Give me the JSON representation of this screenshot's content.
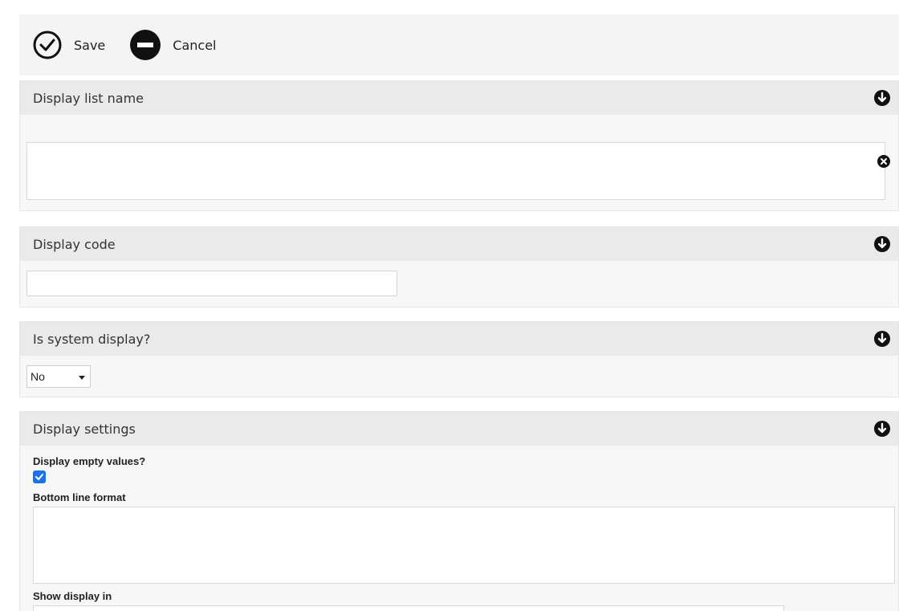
{
  "toolbar": {
    "save_label": "Save",
    "cancel_label": "Cancel"
  },
  "sections": {
    "list_name": {
      "title": "Display list name",
      "value": ""
    },
    "code": {
      "title": "Display code",
      "value": ""
    },
    "system": {
      "title": "Is system display?",
      "selected": "No"
    },
    "settings": {
      "title": "Display settings",
      "empty_values_label": "Display empty values?",
      "empty_values_checked": true,
      "bottom_line_label": "Bottom line format",
      "show_in_label": "Show display in"
    }
  },
  "colors": {
    "checkbox": "#1a73e8",
    "header_bg": "#eaeaea",
    "section_bg": "#f7f7f7"
  }
}
